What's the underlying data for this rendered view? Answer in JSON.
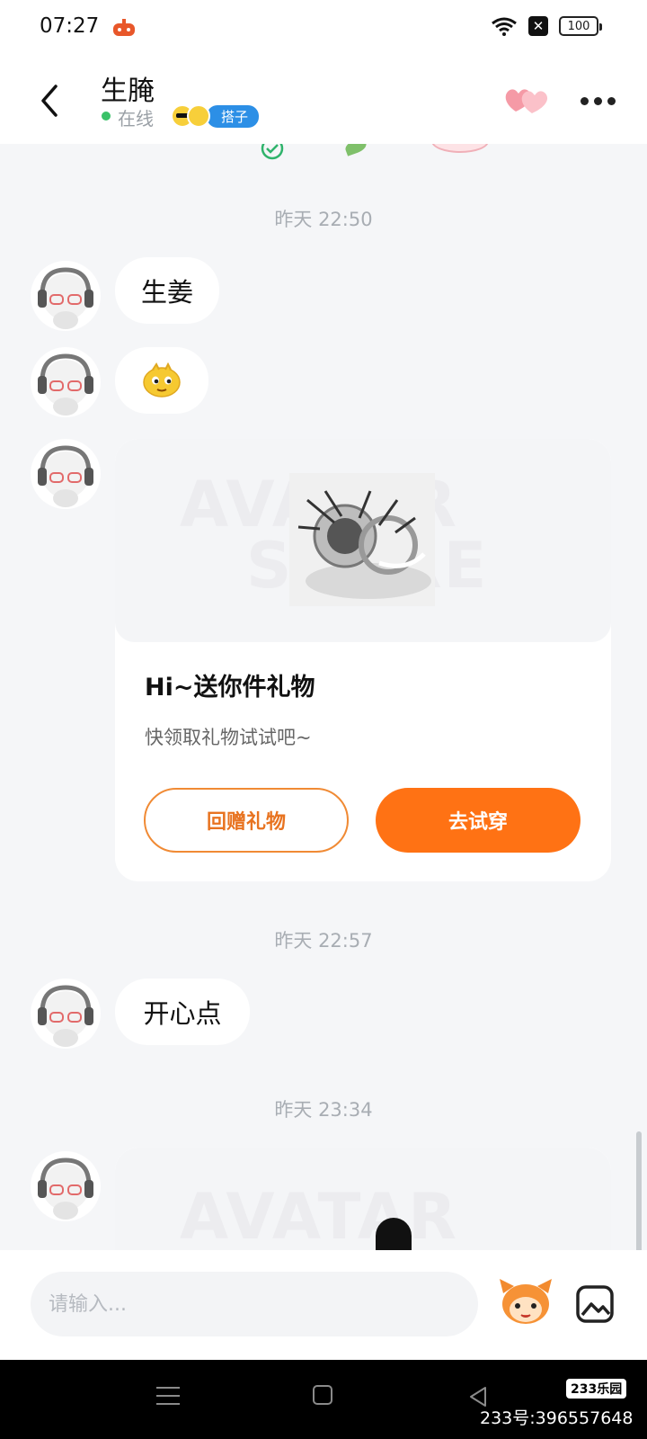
{
  "status_bar": {
    "time": "07:27",
    "battery": "100"
  },
  "header": {
    "name": "生腌",
    "status": "在线",
    "tag": "搭子"
  },
  "chat": {
    "timestamps": [
      "昨天 22:50",
      "昨天 22:57",
      "昨天 23:34"
    ],
    "messages": [
      "生姜",
      "开心点"
    ],
    "gift_card": {
      "watermark_top": "AVATAR",
      "watermark_bottom": "STORE",
      "title": "Hi~送你件礼物",
      "subtitle": "快领取礼物试试吧~",
      "return_gift_label": "回赠礼物",
      "try_on_label": "去试穿"
    },
    "second_card_watermark": "AVATAR"
  },
  "input_bar": {
    "placeholder": "请输入..."
  },
  "nav_bar": {
    "watermark_logo": "233乐园",
    "watermark_id": "233号:396557648"
  },
  "colors": {
    "accent": "#ff7214",
    "online": "#3ac168",
    "tag": "#2c8fe6"
  },
  "icons": [
    "back-icon",
    "hearts-icon",
    "more-icon",
    "emoji-sticker-icon",
    "mascot-icon",
    "gallery-icon"
  ]
}
